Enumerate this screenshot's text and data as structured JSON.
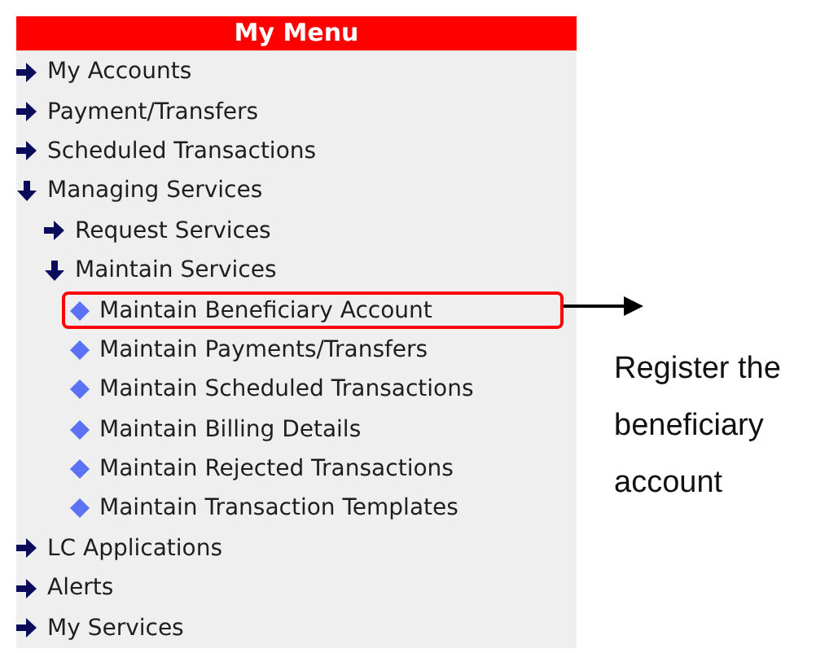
{
  "menu": {
    "title": "My Menu",
    "items": [
      {
        "label": "My Accounts",
        "kind": "folder",
        "expanded": false
      },
      {
        "label": "Payment/Transfers",
        "kind": "folder",
        "expanded": false
      },
      {
        "label": "Scheduled Transactions",
        "kind": "folder",
        "expanded": false
      },
      {
        "label": "Managing Services",
        "kind": "folder",
        "expanded": true,
        "children": [
          {
            "label": "Request Services",
            "kind": "folder",
            "expanded": false
          },
          {
            "label": "Maintain Services",
            "kind": "folder",
            "expanded": true,
            "children": [
              {
                "label": "Maintain Beneficiary Account",
                "kind": "page",
                "highlighted": true
              },
              {
                "label": "Maintain Payments/Transfers",
                "kind": "page",
                "highlighted": false
              },
              {
                "label": "Maintain Scheduled Transactions",
                "kind": "page",
                "highlighted": false
              },
              {
                "label": "Maintain Billing Details",
                "kind": "page",
                "highlighted": false
              },
              {
                "label": "Maintain Rejected Transactions",
                "kind": "page",
                "highlighted": false
              },
              {
                "label": "Maintain Transaction Templates",
                "kind": "page",
                "highlighted": false
              }
            ]
          }
        ]
      },
      {
        "label": "LC Applications",
        "kind": "folder",
        "expanded": false
      },
      {
        "label": "Alerts",
        "kind": "folder",
        "expanded": false
      },
      {
        "label": "My Services",
        "kind": "folder",
        "expanded": false
      }
    ]
  },
  "annotation": {
    "text": "Register the beneficiary account"
  }
}
